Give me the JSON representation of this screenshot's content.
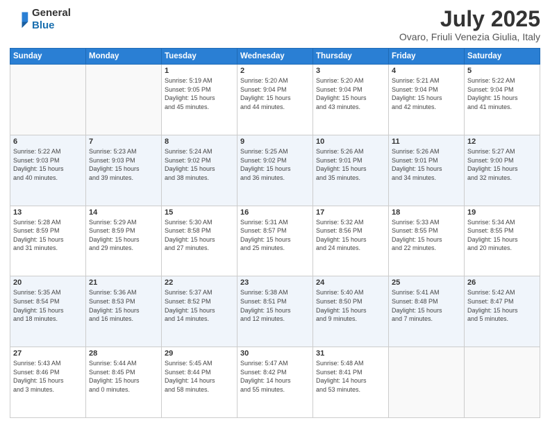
{
  "header": {
    "logo_line1": "General",
    "logo_line2": "Blue",
    "month_year": "July 2025",
    "location": "Ovaro, Friuli Venezia Giulia, Italy"
  },
  "days_of_week": [
    "Sunday",
    "Monday",
    "Tuesday",
    "Wednesday",
    "Thursday",
    "Friday",
    "Saturday"
  ],
  "weeks": [
    [
      {
        "day": "",
        "info": ""
      },
      {
        "day": "",
        "info": ""
      },
      {
        "day": "1",
        "info": "Sunrise: 5:19 AM\nSunset: 9:05 PM\nDaylight: 15 hours\nand 45 minutes."
      },
      {
        "day": "2",
        "info": "Sunrise: 5:20 AM\nSunset: 9:04 PM\nDaylight: 15 hours\nand 44 minutes."
      },
      {
        "day": "3",
        "info": "Sunrise: 5:20 AM\nSunset: 9:04 PM\nDaylight: 15 hours\nand 43 minutes."
      },
      {
        "day": "4",
        "info": "Sunrise: 5:21 AM\nSunset: 9:04 PM\nDaylight: 15 hours\nand 42 minutes."
      },
      {
        "day": "5",
        "info": "Sunrise: 5:22 AM\nSunset: 9:04 PM\nDaylight: 15 hours\nand 41 minutes."
      }
    ],
    [
      {
        "day": "6",
        "info": "Sunrise: 5:22 AM\nSunset: 9:03 PM\nDaylight: 15 hours\nand 40 minutes."
      },
      {
        "day": "7",
        "info": "Sunrise: 5:23 AM\nSunset: 9:03 PM\nDaylight: 15 hours\nand 39 minutes."
      },
      {
        "day": "8",
        "info": "Sunrise: 5:24 AM\nSunset: 9:02 PM\nDaylight: 15 hours\nand 38 minutes."
      },
      {
        "day": "9",
        "info": "Sunrise: 5:25 AM\nSunset: 9:02 PM\nDaylight: 15 hours\nand 36 minutes."
      },
      {
        "day": "10",
        "info": "Sunrise: 5:26 AM\nSunset: 9:01 PM\nDaylight: 15 hours\nand 35 minutes."
      },
      {
        "day": "11",
        "info": "Sunrise: 5:26 AM\nSunset: 9:01 PM\nDaylight: 15 hours\nand 34 minutes."
      },
      {
        "day": "12",
        "info": "Sunrise: 5:27 AM\nSunset: 9:00 PM\nDaylight: 15 hours\nand 32 minutes."
      }
    ],
    [
      {
        "day": "13",
        "info": "Sunrise: 5:28 AM\nSunset: 8:59 PM\nDaylight: 15 hours\nand 31 minutes."
      },
      {
        "day": "14",
        "info": "Sunrise: 5:29 AM\nSunset: 8:59 PM\nDaylight: 15 hours\nand 29 minutes."
      },
      {
        "day": "15",
        "info": "Sunrise: 5:30 AM\nSunset: 8:58 PM\nDaylight: 15 hours\nand 27 minutes."
      },
      {
        "day": "16",
        "info": "Sunrise: 5:31 AM\nSunset: 8:57 PM\nDaylight: 15 hours\nand 25 minutes."
      },
      {
        "day": "17",
        "info": "Sunrise: 5:32 AM\nSunset: 8:56 PM\nDaylight: 15 hours\nand 24 minutes."
      },
      {
        "day": "18",
        "info": "Sunrise: 5:33 AM\nSunset: 8:55 PM\nDaylight: 15 hours\nand 22 minutes."
      },
      {
        "day": "19",
        "info": "Sunrise: 5:34 AM\nSunset: 8:55 PM\nDaylight: 15 hours\nand 20 minutes."
      }
    ],
    [
      {
        "day": "20",
        "info": "Sunrise: 5:35 AM\nSunset: 8:54 PM\nDaylight: 15 hours\nand 18 minutes."
      },
      {
        "day": "21",
        "info": "Sunrise: 5:36 AM\nSunset: 8:53 PM\nDaylight: 15 hours\nand 16 minutes."
      },
      {
        "day": "22",
        "info": "Sunrise: 5:37 AM\nSunset: 8:52 PM\nDaylight: 15 hours\nand 14 minutes."
      },
      {
        "day": "23",
        "info": "Sunrise: 5:38 AM\nSunset: 8:51 PM\nDaylight: 15 hours\nand 12 minutes."
      },
      {
        "day": "24",
        "info": "Sunrise: 5:40 AM\nSunset: 8:50 PM\nDaylight: 15 hours\nand 9 minutes."
      },
      {
        "day": "25",
        "info": "Sunrise: 5:41 AM\nSunset: 8:48 PM\nDaylight: 15 hours\nand 7 minutes."
      },
      {
        "day": "26",
        "info": "Sunrise: 5:42 AM\nSunset: 8:47 PM\nDaylight: 15 hours\nand 5 minutes."
      }
    ],
    [
      {
        "day": "27",
        "info": "Sunrise: 5:43 AM\nSunset: 8:46 PM\nDaylight: 15 hours\nand 3 minutes."
      },
      {
        "day": "28",
        "info": "Sunrise: 5:44 AM\nSunset: 8:45 PM\nDaylight: 15 hours\nand 0 minutes."
      },
      {
        "day": "29",
        "info": "Sunrise: 5:45 AM\nSunset: 8:44 PM\nDaylight: 14 hours\nand 58 minutes."
      },
      {
        "day": "30",
        "info": "Sunrise: 5:47 AM\nSunset: 8:42 PM\nDaylight: 14 hours\nand 55 minutes."
      },
      {
        "day": "31",
        "info": "Sunrise: 5:48 AM\nSunset: 8:41 PM\nDaylight: 14 hours\nand 53 minutes."
      },
      {
        "day": "",
        "info": ""
      },
      {
        "day": "",
        "info": ""
      }
    ]
  ]
}
